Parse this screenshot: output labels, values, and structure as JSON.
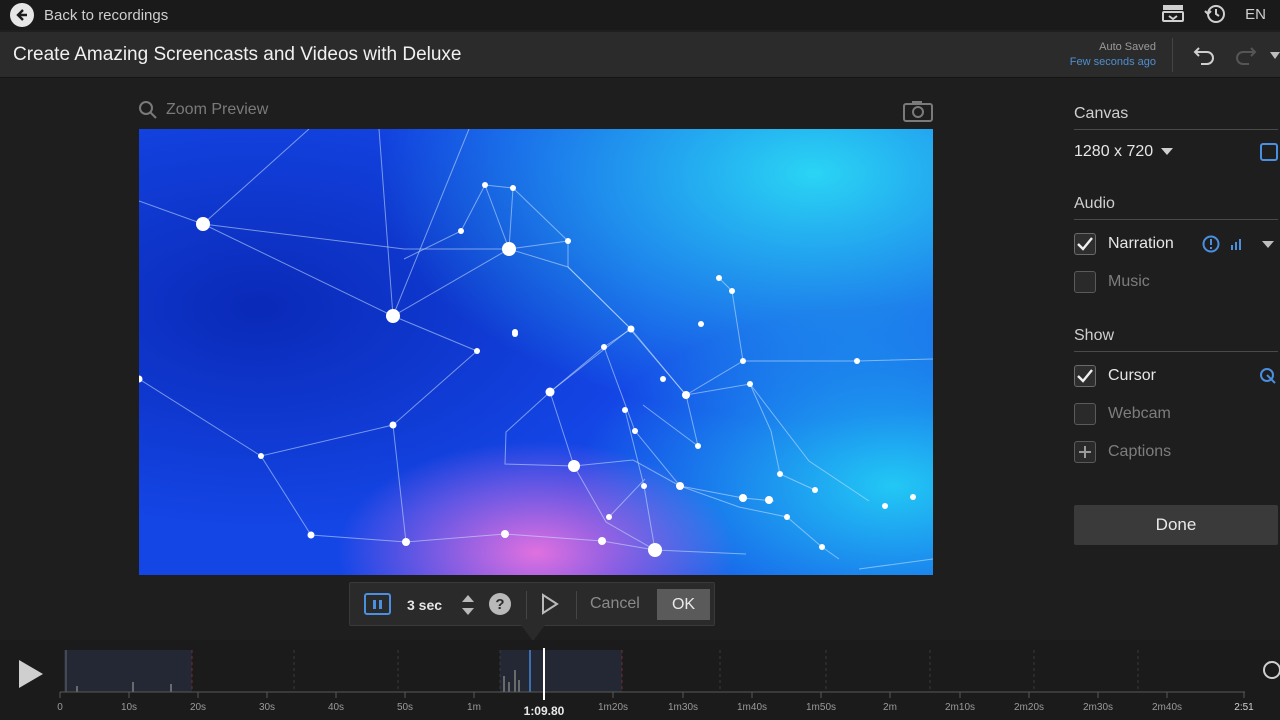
{
  "topbar": {
    "back_label": "Back to recordings",
    "language": "EN"
  },
  "header": {
    "title": "Create Amazing Screencasts and Videos with Deluxe",
    "autosave_label": "Auto Saved",
    "autosave_time": "Few seconds ago"
  },
  "preview": {
    "zoom_label": "Zoom Preview"
  },
  "sidebar": {
    "canvas": {
      "title": "Canvas",
      "size": "1280 x 720"
    },
    "audio": {
      "title": "Audio",
      "narration": "Narration",
      "music": "Music",
      "narration_checked": true,
      "music_checked": false
    },
    "show": {
      "title": "Show",
      "cursor": "Cursor",
      "webcam": "Webcam",
      "captions": "Captions",
      "cursor_checked": true,
      "webcam_checked": false
    },
    "done_label": "Done"
  },
  "pause_popup": {
    "duration": "3 sec",
    "cancel": "Cancel",
    "ok": "OK"
  },
  "timeline": {
    "current_time": "1:09.80",
    "end_time": "2:51",
    "tick_labels": [
      "0",
      "10s",
      "20s",
      "30s",
      "40s",
      "50s",
      "1m",
      "1m20s",
      "1m30s",
      "1m40s",
      "1m50s",
      "2m",
      "2m10s",
      "2m20s",
      "2m30s",
      "2m40s"
    ]
  },
  "colors": {
    "accent_blue": "#4a8fe0",
    "preview_bg": "#1140e0",
    "playhead": "#ffffff"
  }
}
